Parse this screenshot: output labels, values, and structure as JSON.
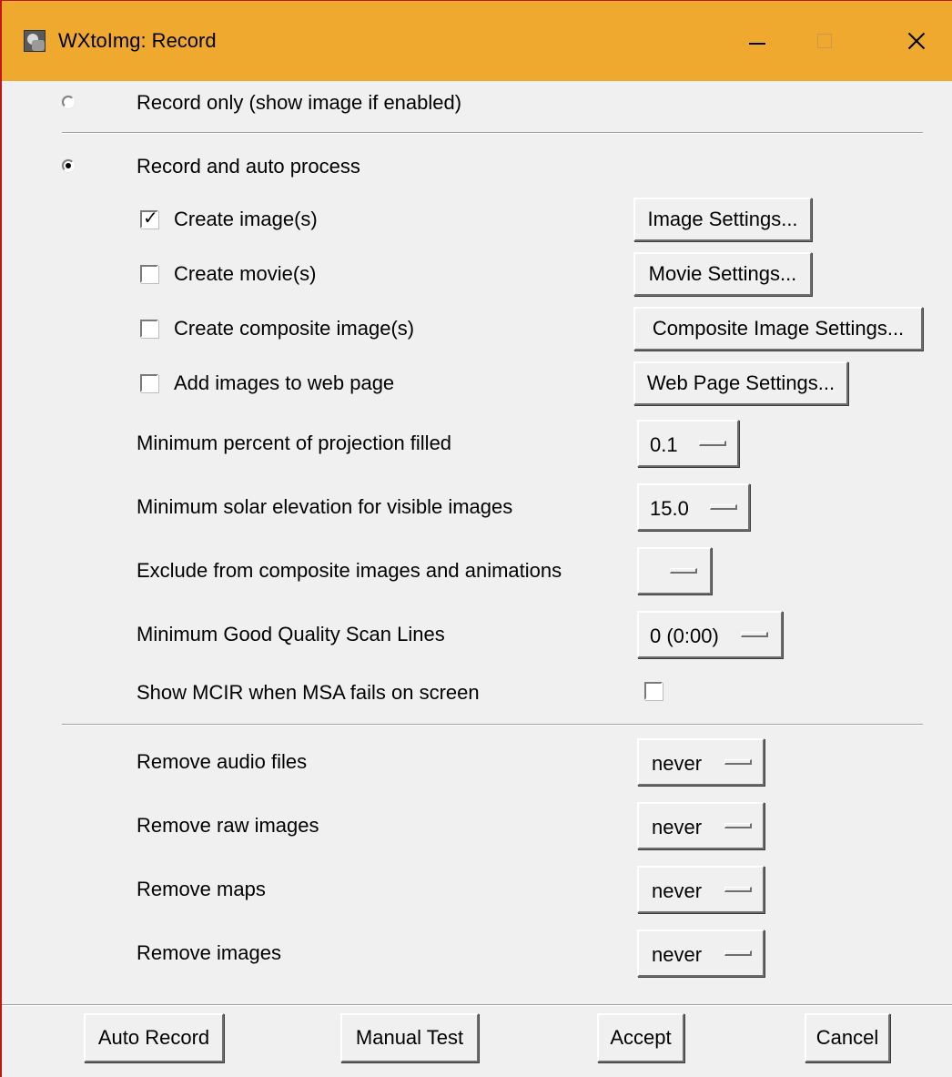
{
  "window": {
    "title": "WXtoImg: Record"
  },
  "mode": {
    "record_only_label": "Record only (show image if enabled)",
    "record_only_selected": false,
    "auto_process_label": "Record and auto process",
    "auto_process_selected": true
  },
  "options": [
    {
      "label": "Create image(s)",
      "checked": true,
      "button": "Image Settings..."
    },
    {
      "label": "Create movie(s)",
      "checked": false,
      "button": "Movie Settings..."
    },
    {
      "label": "Create composite image(s)",
      "checked": false,
      "button": "Composite Image Settings..."
    },
    {
      "label": "Add images to web page",
      "checked": false,
      "button": "Web Page Settings..."
    }
  ],
  "settings": {
    "min_projection": {
      "label": "Minimum percent of projection filled",
      "value": "0.1"
    },
    "min_solar": {
      "label": "Minimum solar elevation for visible images",
      "value": "15.0"
    },
    "exclude": {
      "label": "Exclude from composite images and animations",
      "value": ""
    },
    "min_scan_lines": {
      "label": "Minimum Good Quality Scan Lines",
      "value": "0 (0:00)"
    },
    "show_mcir": {
      "label": "Show MCIR when MSA fails on screen",
      "checked": false
    }
  },
  "removal": {
    "audio": {
      "label": "Remove audio files",
      "value": "never"
    },
    "raw": {
      "label": "Remove raw images",
      "value": "never"
    },
    "maps": {
      "label": "Remove maps",
      "value": "never"
    },
    "images": {
      "label": "Remove images",
      "value": "never"
    }
  },
  "footer": {
    "auto_record": "Auto Record",
    "manual_test": "Manual Test",
    "accept": "Accept",
    "cancel": "Cancel"
  }
}
